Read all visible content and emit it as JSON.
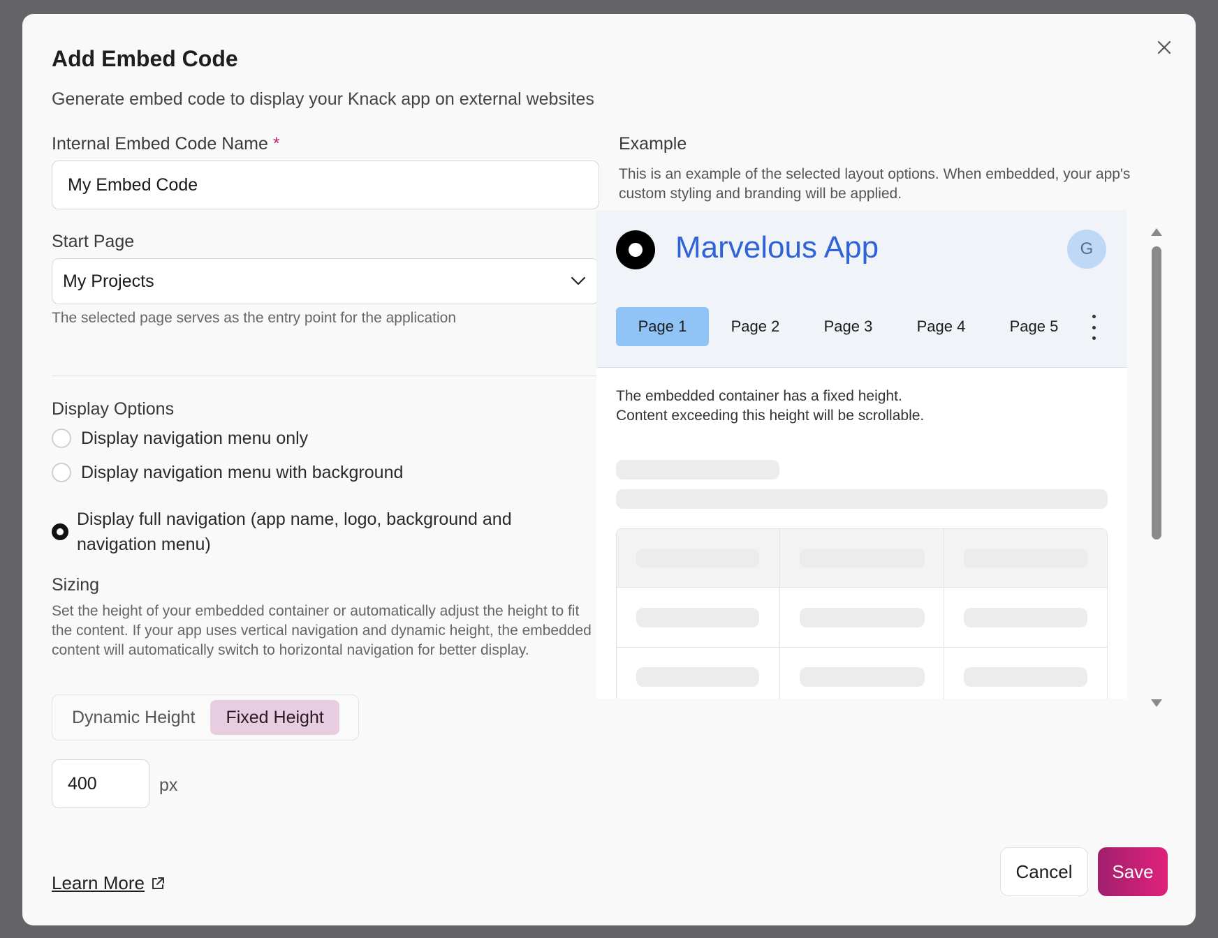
{
  "modal": {
    "title": "Add Embed Code",
    "subtitle": "Generate embed code to display your Knack app on external websites"
  },
  "form": {
    "name_label": "Internal Embed Code Name",
    "name_required_mark": "*",
    "name_value": "My Embed Code",
    "start_page_label": "Start Page",
    "start_page_value": "My Projects",
    "start_page_hint": "The selected page serves as the entry point for the application",
    "display_options_label": "Display Options",
    "display_options": [
      {
        "label": "Display navigation menu only",
        "selected": false
      },
      {
        "label": "Display navigation menu with background",
        "selected": false
      },
      {
        "label": "Display full navigation (app name, logo, background and navigation menu)",
        "selected": true
      }
    ],
    "sizing_label": "Sizing",
    "sizing_hint": "Set the height of your embedded container or automatically adjust the height to fit the content. If your app uses vertical navigation and dynamic height, the embedded content will automatically switch to horizontal navigation for better display.",
    "sizing_modes": {
      "dynamic": "Dynamic Height",
      "fixed": "Fixed Height",
      "selected": "fixed"
    },
    "height_value": "400",
    "height_unit": "px"
  },
  "example": {
    "label": "Example",
    "description": "This is an example of the selected layout options. When embedded, your app's custom styling and branding will be applied.",
    "app_name": "Marvelous App",
    "avatar_initial": "G",
    "tabs": [
      "Page 1",
      "Page 2",
      "Page 3",
      "Page 4",
      "Page 5"
    ],
    "active_tab": "Page 1",
    "body_line1": "The embedded container has a fixed height.",
    "body_line2": "Content exceeding this height will be scrollable."
  },
  "footer": {
    "learn_more": "Learn More",
    "cancel": "Cancel",
    "save": "Save"
  },
  "colors": {
    "save_start": "#a01f6e",
    "save_end": "#e0217a",
    "app_name": "#2f63d8",
    "active_tab": "#90c3f6",
    "fixed_height_active": "#e8cde1"
  }
}
